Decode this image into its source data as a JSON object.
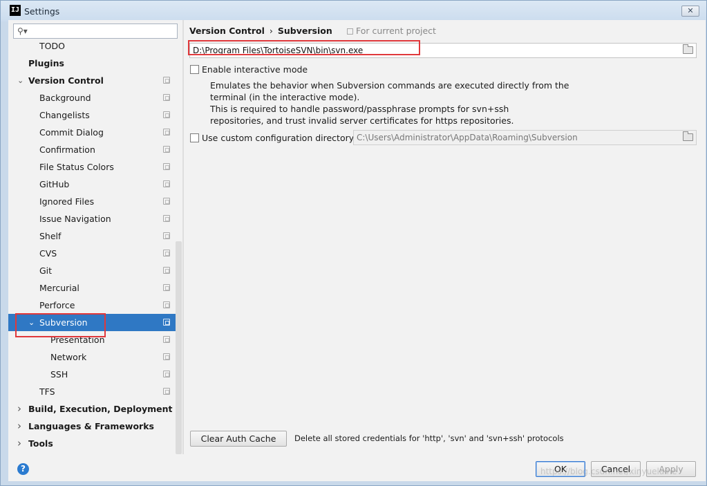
{
  "window": {
    "title": "Settings",
    "app_icon_text": "IJ",
    "close_glyph": "✕"
  },
  "sidebar": {
    "search_placeholder": "",
    "items": [
      {
        "label": "TODO",
        "level": 2,
        "bold": false,
        "expand": "",
        "project": false
      },
      {
        "label": "Plugins",
        "level": 1,
        "bold": true,
        "expand": "",
        "project": false
      },
      {
        "label": "Version Control",
        "level": 1,
        "bold": true,
        "expand": "expanded",
        "project": true
      },
      {
        "label": "Background",
        "level": 2,
        "bold": false,
        "expand": "",
        "project": true
      },
      {
        "label": "Changelists",
        "level": 2,
        "bold": false,
        "expand": "",
        "project": true
      },
      {
        "label": "Commit Dialog",
        "level": 2,
        "bold": false,
        "expand": "",
        "project": true
      },
      {
        "label": "Confirmation",
        "level": 2,
        "bold": false,
        "expand": "",
        "project": true
      },
      {
        "label": "File Status Colors",
        "level": 2,
        "bold": false,
        "expand": "",
        "project": true
      },
      {
        "label": "GitHub",
        "level": 2,
        "bold": false,
        "expand": "",
        "project": true
      },
      {
        "label": "Ignored Files",
        "level": 2,
        "bold": false,
        "expand": "",
        "project": true
      },
      {
        "label": "Issue Navigation",
        "level": 2,
        "bold": false,
        "expand": "",
        "project": true
      },
      {
        "label": "Shelf",
        "level": 2,
        "bold": false,
        "expand": "",
        "project": true
      },
      {
        "label": "CVS",
        "level": 2,
        "bold": false,
        "expand": "",
        "project": true
      },
      {
        "label": "Git",
        "level": 2,
        "bold": false,
        "expand": "",
        "project": true
      },
      {
        "label": "Mercurial",
        "level": 2,
        "bold": false,
        "expand": "",
        "project": true
      },
      {
        "label": "Perforce",
        "level": 2,
        "bold": false,
        "expand": "",
        "project": true
      },
      {
        "label": "Subversion",
        "level": 2,
        "bold": false,
        "expand": "expanded",
        "project": true,
        "selected": true
      },
      {
        "label": "Presentation",
        "level": 3,
        "bold": false,
        "expand": "",
        "project": true
      },
      {
        "label": "Network",
        "level": 3,
        "bold": false,
        "expand": "",
        "project": true
      },
      {
        "label": "SSH",
        "level": 3,
        "bold": false,
        "expand": "",
        "project": true
      },
      {
        "label": "TFS",
        "level": 2,
        "bold": false,
        "expand": "",
        "project": true
      },
      {
        "label": "Build, Execution, Deployment",
        "level": 1,
        "bold": true,
        "expand": "collapsed",
        "project": false
      },
      {
        "label": "Languages & Frameworks",
        "level": 1,
        "bold": true,
        "expand": "collapsed",
        "project": false
      },
      {
        "label": "Tools",
        "level": 1,
        "bold": true,
        "expand": "collapsed",
        "project": false
      }
    ]
  },
  "content": {
    "breadcrumb_parent": "Version Control",
    "breadcrumb_sep": "›",
    "breadcrumb_current": "Subversion",
    "for_current_project": "For current project",
    "svn_path": "D:\\Program Files\\TortoiseSVN\\bin\\svn.exe",
    "interactive_mode_label": "Enable interactive mode",
    "interactive_mode_checked": false,
    "description_lines": [
      "Emulates the behavior when Subversion commands are executed directly from the",
      "terminal (in the interactive mode).",
      "This is required to handle password/passphrase prompts for svn+ssh",
      "repositories, and trust invalid server certificates for https repositories."
    ],
    "custom_config_label": "Use custom configuration directory:",
    "custom_config_checked": false,
    "custom_config_path": "C:\\Users\\Administrator\\AppData\\Roaming\\Subversion",
    "clear_cache_label": "Clear Auth Cache",
    "clear_cache_desc": "Delete all stored credentials for 'http', 'svn' and 'svn+ssh' protocols"
  },
  "footer": {
    "help_glyph": "?",
    "ok_label": "OK",
    "cancel_label": "Cancel",
    "apply_label": "Apply",
    "watermark": "https://blog.csdn.net/xinyuelaine"
  },
  "colors": {
    "selection": "#2f78c4",
    "highlight_box": "#e0383b",
    "help": "#2b7bd0"
  }
}
